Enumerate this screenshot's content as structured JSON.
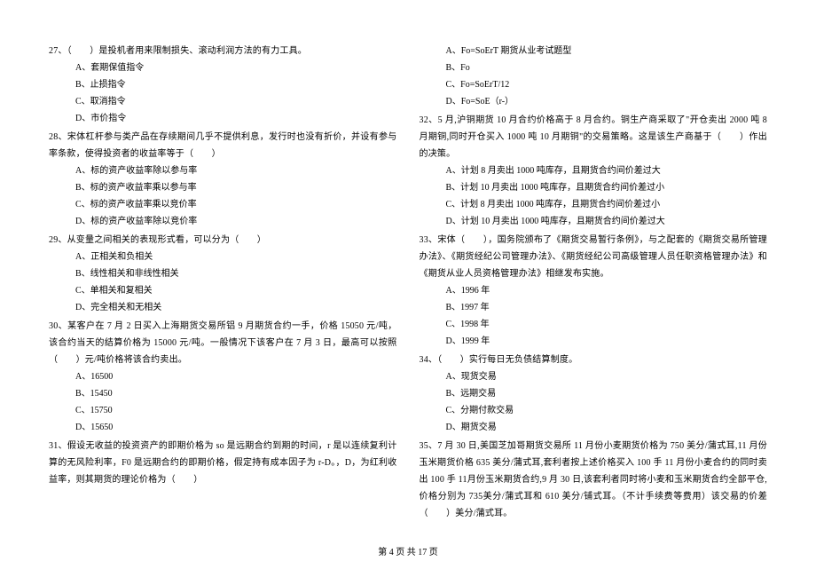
{
  "left_column": {
    "q27": {
      "text": "27、（　　）是投机者用来限制损失、滚动利润方法的有力工具。",
      "options": {
        "a": "A、套期保值指令",
        "b": "B、止损指令",
        "c": "C、取消指令",
        "d": "D、市价指令"
      }
    },
    "q28": {
      "text": "28、宋体杠杆参与类产品在存续期间几乎不提供利息，发行时也没有折价，并设有参与率条款，使得投资者的收益率等于（　　）",
      "options": {
        "a": "A、标的资产收益率除以参与率",
        "b": "B、标的资产收益率乘以参与率",
        "c": "C、标的资产收益率乘以竞价率",
        "d": "D、标的资产收益率除以竞价率"
      }
    },
    "q29": {
      "text": "29、从变量之间相关的表现形式看，可以分为（　　）",
      "options": {
        "a": "A、正相关和负相关",
        "b": "B、线性相关和非线性相关",
        "c": "C、单相关和复相关",
        "d": "D、完全相关和无相关"
      }
    },
    "q30": {
      "text": "30、某客户在 7 月 2 日买入上海期货交易所铝 9 月期货合约一手，价格 15050 元/吨，该合约当天的结算价格为 15000 元/吨。一般情况下该客户在 7 月 3 日，最高可以按照（　　）元/吨价格将该合约卖出。",
      "options": {
        "a": "A、16500",
        "b": "B、15450",
        "c": "C、15750",
        "d": "D、15650"
      }
    },
    "q31": {
      "text": "31、假设无收益的投资资产的即期价格为 so 是远期合约到期的时间，r 是以连续复利计算的无风险利率，F0 是远期合约的即期价格，假定持有成本因子为 r-D。，D，为红利收益率，则其期货的理论价格为（　　）"
    }
  },
  "right_column": {
    "q31_options": {
      "a": "A、Fo=SoErT 期货从业考试题型",
      "b": "B、Fo",
      "c": "C、Fo=SoErT/12",
      "d": "D、Fo=SoE（r-）"
    },
    "q32": {
      "text": "32、5 月,沪铜期货 10 月合约价格高于 8 月合约。铜生产商采取了\"开仓卖出 2000 吨 8 月期铜,同时开仓买入 1000 吨 10 月期铜\"的交易策略。这是该生产商基于（　　）作出的决策。",
      "options": {
        "a": "A、计划 8 月卖出 1000 吨库存，且期货合约间价差过大",
        "b": "B、计划 10 月卖出 1000 吨库存，且期货合约间价差过小",
        "c": "C、计划 8 月卖出 1000 吨库存，且期货合约间价差过小",
        "d": "D、计划 10 月卖出 1000 吨库存，且期货合约间价差过大"
      }
    },
    "q33": {
      "text": "33、宋体（　　），国务院颁布了《期货交易暂行条例》，与之配套的《期货交易所管理办法》、《期货经纪公司管理办法》、《期货经纪公司高级管理人员任职资格管理办法》和《期货从业人员资格管理办法》相继发布实施。",
      "options": {
        "a": "A、1996 年",
        "b": "B、1997 年",
        "c": "C、1998 年",
        "d": "D、1999 年"
      }
    },
    "q34": {
      "text": "34、（　　）实行每日无负债结算制度。",
      "options": {
        "a": "A、现货交易",
        "b": "B、远期交易",
        "c": "C、分期付款交易",
        "d": "D、期货交易"
      }
    },
    "q35": {
      "text": "35、7 月 30 日,美国芝加哥期货交易所 11 月份小麦期货价格为 750 美分/蒲式耳,11 月份玉米期货价格 635 美分/蒲式耳,套利者按上述价格买入 100 手 11 月份小麦合约的同时卖出 100 手 11月份玉米期货合约,9 月 30 日,该套利者同时将小麦和玉米期货合约全部平仓,价格分别为 735美分/蒲式耳和 610 美分/铺式耳。（不计手续费等费用）该交易的价差（　　）美分/蒲式耳。"
    }
  },
  "footer": "第 4 页 共 17 页"
}
